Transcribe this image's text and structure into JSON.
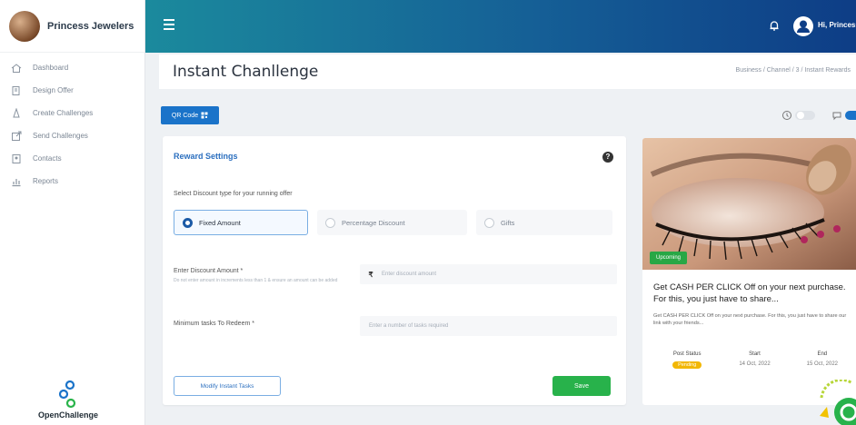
{
  "brand": {
    "name": "Princess Jewelers"
  },
  "sidebar": {
    "items": [
      {
        "label": "Dashboard",
        "icon": "dashboard-icon"
      },
      {
        "label": "Design Offer",
        "icon": "design-icon"
      },
      {
        "label": "Create Challenges",
        "icon": "challenge-icon"
      },
      {
        "label": "Send Challenges",
        "icon": "send-icon"
      },
      {
        "label": "Contacts",
        "icon": "contacts-icon"
      },
      {
        "label": "Reports",
        "icon": "reports-icon"
      }
    ],
    "logo_text": "OpenChallenge"
  },
  "header": {
    "user_label": "Hi, Princess"
  },
  "page": {
    "title": "Instant Chanllenge",
    "breadcrumb": "Business / Channel / 3 / Instant Rewards"
  },
  "toolbar": {
    "qr_label": "QR Code"
  },
  "reward": {
    "title": "Reward Settings",
    "select_text": "Select Discount type for your running offer",
    "options": [
      "Fixed Amount",
      "Percentage Discount",
      "Gifts"
    ],
    "amount_label": "Enter Discount Amount *",
    "amount_help": "Do not enter amount in increments less than 1 & ensure an amount can be added",
    "currency": "₹",
    "amount_placeholder": "Enter discount amount",
    "tasks_label": "Minimum tasks To Redeem *",
    "tasks_placeholder": "Enter a number of tasks required",
    "modify_label": "Modify Instant Tasks",
    "save_label": "Save"
  },
  "preview": {
    "badge": "Upcoming",
    "headline": "Get CASH PER CLICK Off on your next purchase. For this, you just have to share...",
    "body": "Get CASH PER CLICK Off on your next purchase. For this, you just have to share our link with your friends...",
    "columns": [
      {
        "head": "Post Status",
        "value": "Pending"
      },
      {
        "head": "Start",
        "value": "14 Oct, 2022"
      },
      {
        "head": "End",
        "value": "15 Oct, 2022"
      }
    ]
  },
  "colors": {
    "primary": "#1a73c9",
    "save": "#28b24b",
    "pending": "#f2b705"
  }
}
